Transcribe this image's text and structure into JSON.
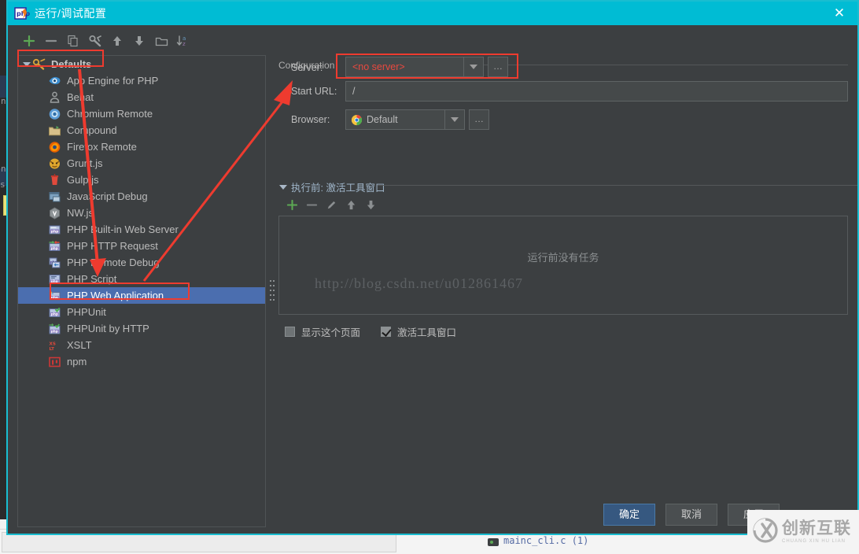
{
  "window": {
    "title": "运行/调试配置",
    "icon": "phpstorm-icon",
    "close_label": "✕",
    "accent_color": "#00bcd4",
    "panel_color": "#3c3f41"
  },
  "toolbar": {
    "items": [
      {
        "name": "add",
        "icon": "plus-icon",
        "label": "+"
      },
      {
        "name": "remove",
        "icon": "minus-icon",
        "label": "−"
      },
      {
        "name": "copy",
        "icon": "copy-icon",
        "label": ""
      },
      {
        "name": "edit-templates",
        "icon": "wrench-icon",
        "label": ""
      },
      {
        "name": "move-up",
        "icon": "arrow-up-icon",
        "label": ""
      },
      {
        "name": "move-down",
        "icon": "arrow-down-icon",
        "label": ""
      },
      {
        "name": "new-folder",
        "icon": "folder-icon",
        "label": ""
      },
      {
        "name": "sort-alphabetically",
        "icon": "sort-az-icon",
        "label": ""
      }
    ]
  },
  "tree": {
    "root": {
      "label": "Defaults",
      "icon": "wrench-icon",
      "expanded": true
    },
    "items": [
      {
        "label": "App Engine for PHP",
        "icon": "app-engine-icon",
        "selected": false
      },
      {
        "label": "Behat",
        "icon": "behat-icon",
        "selected": false
      },
      {
        "label": "Chromium Remote",
        "icon": "chromium-icon",
        "selected": false
      },
      {
        "label": "Compound",
        "icon": "folder-icon",
        "selected": false
      },
      {
        "label": "Firefox Remote",
        "icon": "firefox-icon",
        "selected": false
      },
      {
        "label": "Grunt.js",
        "icon": "grunt-icon",
        "selected": false
      },
      {
        "label": "Gulp.js",
        "icon": "gulp-icon",
        "selected": false
      },
      {
        "label": "JavaScript Debug",
        "icon": "js-debug-icon",
        "selected": false
      },
      {
        "label": "NW.js",
        "icon": "nwjs-icon",
        "selected": false
      },
      {
        "label": "PHP Built-in Web Server",
        "icon": "php-icon",
        "selected": false
      },
      {
        "label": "PHP HTTP Request",
        "icon": "php-http-icon",
        "selected": false
      },
      {
        "label": "PHP Remote Debug",
        "icon": "php-remote-icon",
        "selected": false
      },
      {
        "label": "PHP Script",
        "icon": "php-script-icon",
        "selected": false
      },
      {
        "label": "PHP Web Application",
        "icon": "php-web-icon",
        "selected": true
      },
      {
        "label": "PHPUnit",
        "icon": "phpunit-icon",
        "selected": false
      },
      {
        "label": "PHPUnit by HTTP",
        "icon": "phpunit-http-icon",
        "selected": false
      },
      {
        "label": "XSLT",
        "icon": "xslt-icon",
        "selected": false
      },
      {
        "label": "npm",
        "icon": "npm-icon",
        "selected": false
      }
    ]
  },
  "configuration": {
    "group_title": "Configuration",
    "server": {
      "label": "Server:",
      "value": "<no server>",
      "value_color": "#e8493f",
      "browse_label": "…"
    },
    "start_url": {
      "label": "Start URL:",
      "value": "/"
    },
    "browser": {
      "label": "Browser:",
      "value": "Default",
      "icon": "chrome-icon",
      "browse_label": "…"
    }
  },
  "before_launch": {
    "title": "执行前: 激活工具窗口",
    "toolbar": [
      {
        "name": "add-task",
        "icon": "plus-icon"
      },
      {
        "name": "remove-task",
        "icon": "minus-icon"
      },
      {
        "name": "edit-task",
        "icon": "pencil-icon"
      },
      {
        "name": "move-task-up",
        "icon": "arrow-up-icon"
      },
      {
        "name": "move-task-down",
        "icon": "arrow-down-icon"
      }
    ],
    "empty_text": "运行前没有任务",
    "checkboxes": [
      {
        "label": "显示这个页面",
        "checked": false
      },
      {
        "label": "激活工具窗口",
        "checked": true
      }
    ]
  },
  "buttons": {
    "ok": "确定",
    "cancel": "取消",
    "apply": "应用"
  },
  "watermarks": {
    "url": "http://blog.csdn.net/u012861467",
    "logo_cn": "创新互联",
    "logo_en": "CHUANG XIN HU LIAN"
  },
  "background": {
    "tab_label": "mainc_cli.c (1)"
  }
}
